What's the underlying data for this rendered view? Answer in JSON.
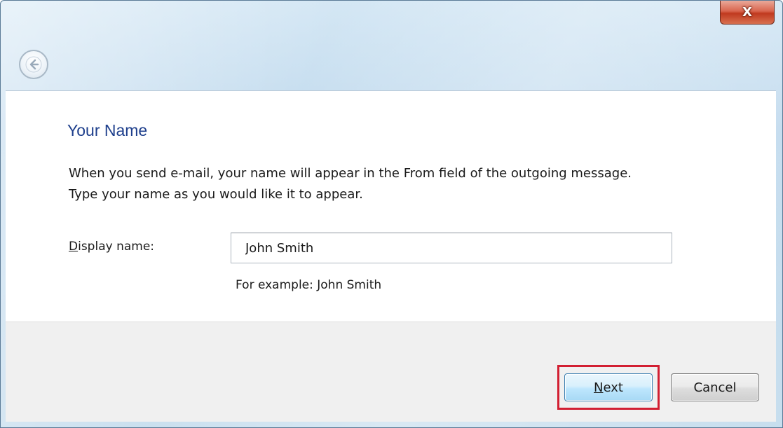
{
  "window": {
    "close_glyph": "X"
  },
  "nav": {
    "back_icon": "back-arrow-icon"
  },
  "page": {
    "title": "Your Name",
    "description_line1": "When you send e-mail, your name will appear in the From field of the outgoing message.",
    "description_line2": "Type your name as you would like it to appear."
  },
  "form": {
    "display_name_label_accel": "D",
    "display_name_label_rest": "isplay name:",
    "display_name_value": "John Smith",
    "example_text": "For example: John Smith"
  },
  "buttons": {
    "next_accel": "N",
    "next_rest": "ext",
    "cancel_label": "Cancel"
  },
  "colors": {
    "title": "#1e3f8c",
    "highlight": "#d21f32",
    "footer_bg": "#f0f0f0"
  }
}
